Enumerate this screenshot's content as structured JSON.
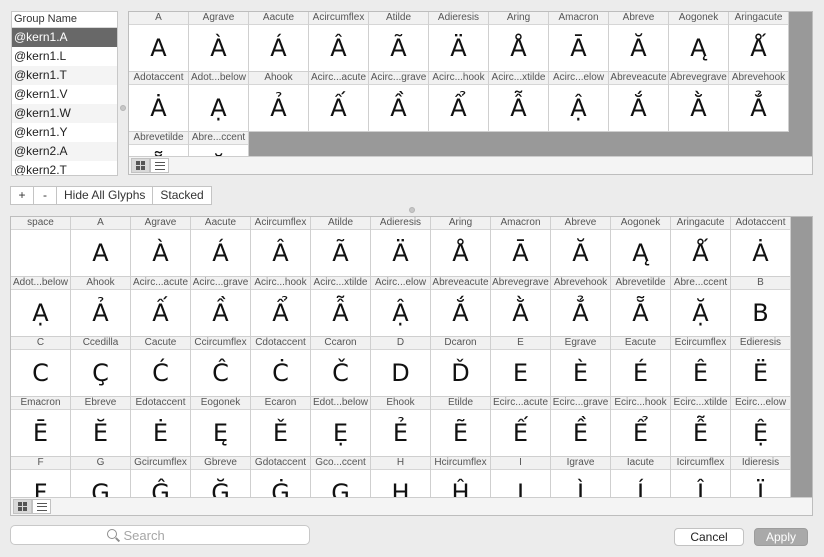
{
  "group_list": {
    "header": "Group Name",
    "items": [
      "@kern1.A",
      "@kern1.L",
      "@kern1.T",
      "@kern1.V",
      "@kern1.W",
      "@kern1.Y",
      "@kern2.A",
      "@kern2.T"
    ],
    "selected_index": 0
  },
  "top_grid": {
    "cells": [
      {
        "name": "A",
        "glyph": "A"
      },
      {
        "name": "Agrave",
        "glyph": "À"
      },
      {
        "name": "Aacute",
        "glyph": "Á"
      },
      {
        "name": "Acircumflex",
        "glyph": "Â"
      },
      {
        "name": "Atilde",
        "glyph": "Ã"
      },
      {
        "name": "Adieresis",
        "glyph": "Ä"
      },
      {
        "name": "Aring",
        "glyph": "Å"
      },
      {
        "name": "Amacron",
        "glyph": "Ā"
      },
      {
        "name": "Abreve",
        "glyph": "Ă"
      },
      {
        "name": "Aogonek",
        "glyph": "Ą"
      },
      {
        "name": "Aringacute",
        "glyph": "Ǻ"
      },
      {
        "name": "Adotaccent",
        "glyph": "Ȧ"
      },
      {
        "name": "Adot...below",
        "glyph": "Ạ"
      },
      {
        "name": "Ahook",
        "glyph": "Ả"
      },
      {
        "name": "Acirc...acute",
        "glyph": "Ấ"
      },
      {
        "name": "Acirc...grave",
        "glyph": "Ầ"
      },
      {
        "name": "Acirc...hook",
        "glyph": "Ẩ"
      },
      {
        "name": "Acirc...xtilde",
        "glyph": "Ẫ"
      },
      {
        "name": "Acirc...elow",
        "glyph": "Ậ"
      },
      {
        "name": "Abreveacute",
        "glyph": "Ắ"
      },
      {
        "name": "Abrevegrave",
        "glyph": "Ằ"
      },
      {
        "name": "Abrevehook",
        "glyph": "Ẳ"
      },
      {
        "name": "Abrevetilde",
        "glyph": "Ẵ"
      },
      {
        "name": "Abre...ccent",
        "glyph": "Ặ"
      }
    ]
  },
  "toolbar": {
    "add_label": "+",
    "remove_label": "-",
    "hide_all_label": "Hide All Glyphs",
    "stacked_label": "Stacked"
  },
  "bottom_grid": {
    "cells": [
      {
        "name": "space",
        "glyph": ""
      },
      {
        "name": "A",
        "glyph": "A"
      },
      {
        "name": "Agrave",
        "glyph": "À"
      },
      {
        "name": "Aacute",
        "glyph": "Á"
      },
      {
        "name": "Acircumflex",
        "glyph": "Â"
      },
      {
        "name": "Atilde",
        "glyph": "Ã"
      },
      {
        "name": "Adieresis",
        "glyph": "Ä"
      },
      {
        "name": "Aring",
        "glyph": "Å"
      },
      {
        "name": "Amacron",
        "glyph": "Ā"
      },
      {
        "name": "Abreve",
        "glyph": "Ă"
      },
      {
        "name": "Aogonek",
        "glyph": "Ą"
      },
      {
        "name": "Aringacute",
        "glyph": "Ǻ"
      },
      {
        "name": "Adotaccent",
        "glyph": "Ȧ"
      },
      {
        "name": "Adot...below",
        "glyph": "Ạ"
      },
      {
        "name": "Ahook",
        "glyph": "Ả"
      },
      {
        "name": "Acirc...acute",
        "glyph": "Ấ"
      },
      {
        "name": "Acirc...grave",
        "glyph": "Ầ"
      },
      {
        "name": "Acirc...hook",
        "glyph": "Ẩ"
      },
      {
        "name": "Acirc...xtilde",
        "glyph": "Ẫ"
      },
      {
        "name": "Acirc...elow",
        "glyph": "Ậ"
      },
      {
        "name": "Abreveacute",
        "glyph": "Ắ"
      },
      {
        "name": "Abrevegrave",
        "glyph": "Ằ"
      },
      {
        "name": "Abrevehook",
        "glyph": "Ẳ"
      },
      {
        "name": "Abrevetilde",
        "glyph": "Ẵ"
      },
      {
        "name": "Abre...ccent",
        "glyph": "Ặ"
      },
      {
        "name": "B",
        "glyph": "B"
      },
      {
        "name": "C",
        "glyph": "C"
      },
      {
        "name": "Ccedilla",
        "glyph": "Ç"
      },
      {
        "name": "Cacute",
        "glyph": "Ć"
      },
      {
        "name": "Ccircumflex",
        "glyph": "Ĉ"
      },
      {
        "name": "Cdotaccent",
        "glyph": "Ċ"
      },
      {
        "name": "Ccaron",
        "glyph": "Č"
      },
      {
        "name": "D",
        "glyph": "D"
      },
      {
        "name": "Dcaron",
        "glyph": "Ď"
      },
      {
        "name": "E",
        "glyph": "E"
      },
      {
        "name": "Egrave",
        "glyph": "È"
      },
      {
        "name": "Eacute",
        "glyph": "É"
      },
      {
        "name": "Ecircumflex",
        "glyph": "Ê"
      },
      {
        "name": "Edieresis",
        "glyph": "Ë"
      },
      {
        "name": "Emacron",
        "glyph": "Ē"
      },
      {
        "name": "Ebreve",
        "glyph": "Ĕ"
      },
      {
        "name": "Edotaccent",
        "glyph": "Ė"
      },
      {
        "name": "Eogonek",
        "glyph": "Ę"
      },
      {
        "name": "Ecaron",
        "glyph": "Ě"
      },
      {
        "name": "Edot...below",
        "glyph": "Ẹ"
      },
      {
        "name": "Ehook",
        "glyph": "Ẻ"
      },
      {
        "name": "Etilde",
        "glyph": "Ẽ"
      },
      {
        "name": "Ecirc...acute",
        "glyph": "Ế"
      },
      {
        "name": "Ecirc...grave",
        "glyph": "Ề"
      },
      {
        "name": "Ecirc...hook",
        "glyph": "Ể"
      },
      {
        "name": "Ecirc...xtilde",
        "glyph": "Ễ"
      },
      {
        "name": "Ecirc...elow",
        "glyph": "Ệ"
      },
      {
        "name": "F",
        "glyph": "F"
      },
      {
        "name": "G",
        "glyph": "G"
      },
      {
        "name": "Gcircumflex",
        "glyph": "Ĝ"
      },
      {
        "name": "Gbreve",
        "glyph": "Ğ"
      },
      {
        "name": "Gdotaccent",
        "glyph": "Ġ"
      },
      {
        "name": "Gco...ccent",
        "glyph": "Ģ"
      },
      {
        "name": "H",
        "glyph": "H"
      },
      {
        "name": "Hcircumflex",
        "glyph": "Ĥ"
      },
      {
        "name": "I",
        "glyph": "I"
      },
      {
        "name": "Igrave",
        "glyph": "Ì"
      },
      {
        "name": "Iacute",
        "glyph": "Í"
      },
      {
        "name": "Icircumflex",
        "glyph": "Î"
      },
      {
        "name": "Idieresis",
        "glyph": "Ï"
      }
    ]
  },
  "search": {
    "placeholder": "Search",
    "value": ""
  },
  "dialog": {
    "cancel_label": "Cancel",
    "apply_label": "Apply"
  },
  "icons": {
    "grid_view": "grid-view-icon",
    "list_view": "list-view-icon",
    "search": "search-icon"
  },
  "colors": {
    "selection": "#686868",
    "panel_bg": "#999999",
    "apply_button": "#a9a9a9"
  }
}
